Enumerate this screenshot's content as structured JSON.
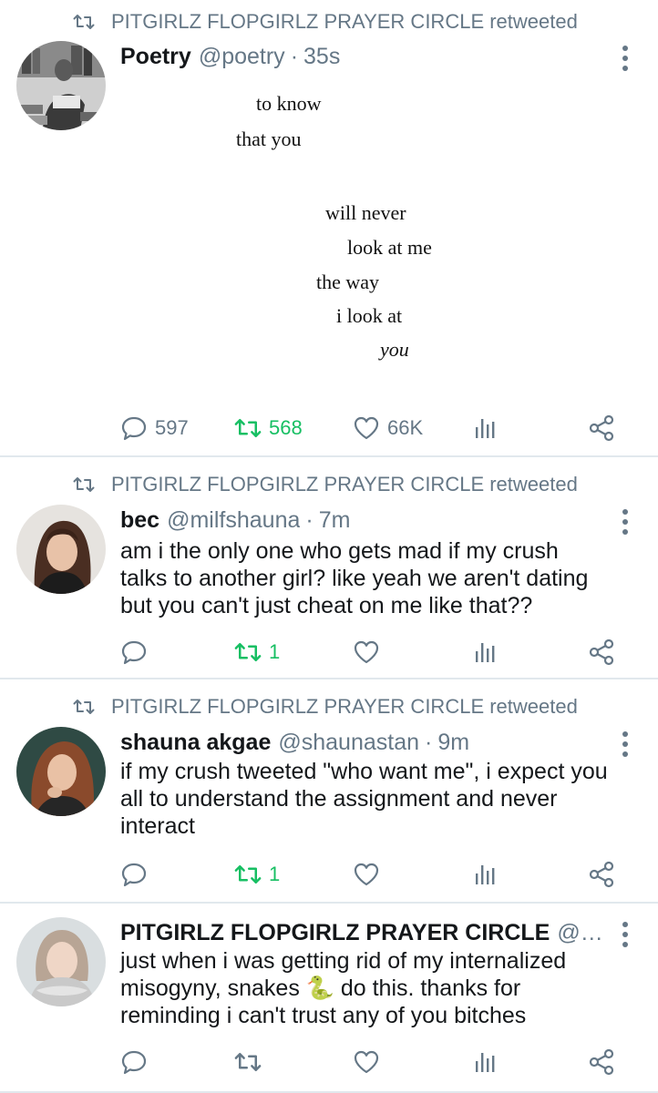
{
  "colors": {
    "retweet_green": "#17bf63",
    "muted": "#657786",
    "divider": "#e1e8ed"
  },
  "tweets": [
    {
      "retweeted_by": "PITGIRLZ FLOPGIRLZ PRAYER CIRCLE retweeted",
      "name": "Poetry",
      "handle": "@poetry",
      "time": "35s",
      "poem_lines": [
        "to know",
        "that you",
        "will never",
        "look at me",
        "the way",
        "i look at",
        "you"
      ],
      "reply_count": "597",
      "retweet_count": "568",
      "like_count": "66K",
      "retweeted": true
    },
    {
      "retweeted_by": "PITGIRLZ FLOPGIRLZ PRAYER CIRCLE retweeted",
      "name": "bec",
      "handle": "@milfshauna",
      "time": "7m",
      "text": "am i the only one who gets mad if my crush\ntalks to another girl? like yeah we aren't dating\nbut you can't just cheat on me like that??",
      "reply_count": "",
      "retweet_count": "1",
      "like_count": "",
      "retweeted": true
    },
    {
      "retweeted_by": "PITGIRLZ FLOPGIRLZ PRAYER CIRCLE retweeted",
      "name": "shauna akgae",
      "handle": "@shaunastan",
      "time": "9m",
      "text": "if my crush tweeted \"who want me\", i expect you\nall to understand the assignment and never\ninteract",
      "reply_count": "",
      "retweet_count": "1",
      "like_count": "",
      "retweeted": true
    },
    {
      "name": "PITGIRLZ FLOPGIRLZ PRAYER CIRCLE",
      "handle": "@sh...",
      "text": "just when i was getting rid of my internalized\nmisogyny, snakes 🐍 do this. thanks for\nreminding i can't trust any of you bitches",
      "reply_count": "",
      "retweet_count": "",
      "like_count": "",
      "retweeted": false
    }
  ],
  "icons": [
    "retweet-icon",
    "reply-icon",
    "like-icon",
    "analytics-icon",
    "share-icon",
    "more-options-icon"
  ]
}
